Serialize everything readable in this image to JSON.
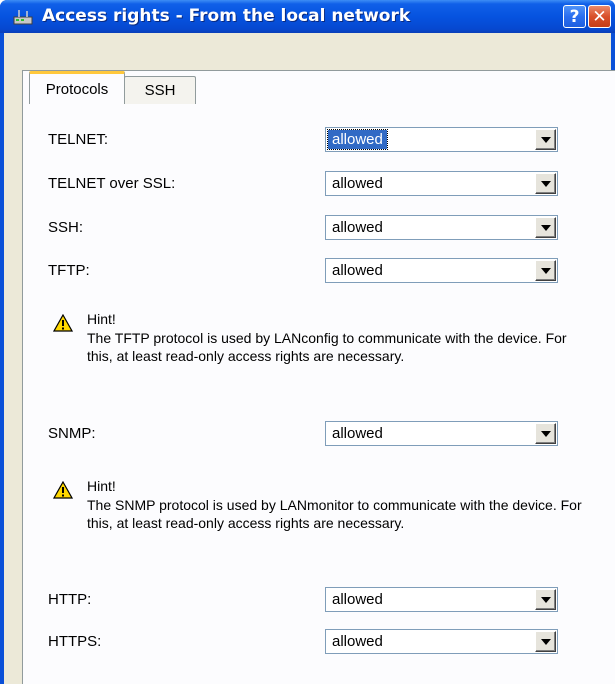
{
  "window": {
    "title": "Access rights - From the local network",
    "help_label": "?",
    "close_label": "✕"
  },
  "tabs": [
    {
      "label": "Protocols",
      "active": true
    },
    {
      "label": "SSH",
      "active": false
    }
  ],
  "rows": [
    {
      "label": "TELNET:",
      "value": "allowed"
    },
    {
      "label": "TELNET over SSL:",
      "value": "allowed"
    },
    {
      "label": "SSH:",
      "value": "allowed"
    },
    {
      "label": "TFTP:",
      "value": "allowed"
    },
    {
      "label": "SNMP:",
      "value": "allowed"
    },
    {
      "label": "HTTP:",
      "value": "allowed"
    },
    {
      "label": "HTTPS:",
      "value": "allowed"
    }
  ],
  "hints": [
    {
      "title": "Hint!",
      "body": "The TFTP protocol is used by LANconfig to communicate with the device. For this, at least read-only access rights are necessary."
    },
    {
      "title": "Hint!",
      "body": "The SNMP protocol is used by LANmonitor to communicate with the device. For this, at least read-only access rights are necessary."
    }
  ],
  "colors": {
    "titlebar": "#0653e0",
    "dialog_bg": "#ece9d8",
    "selection": "#316ac5",
    "hint_icon": "#ffd800"
  }
}
